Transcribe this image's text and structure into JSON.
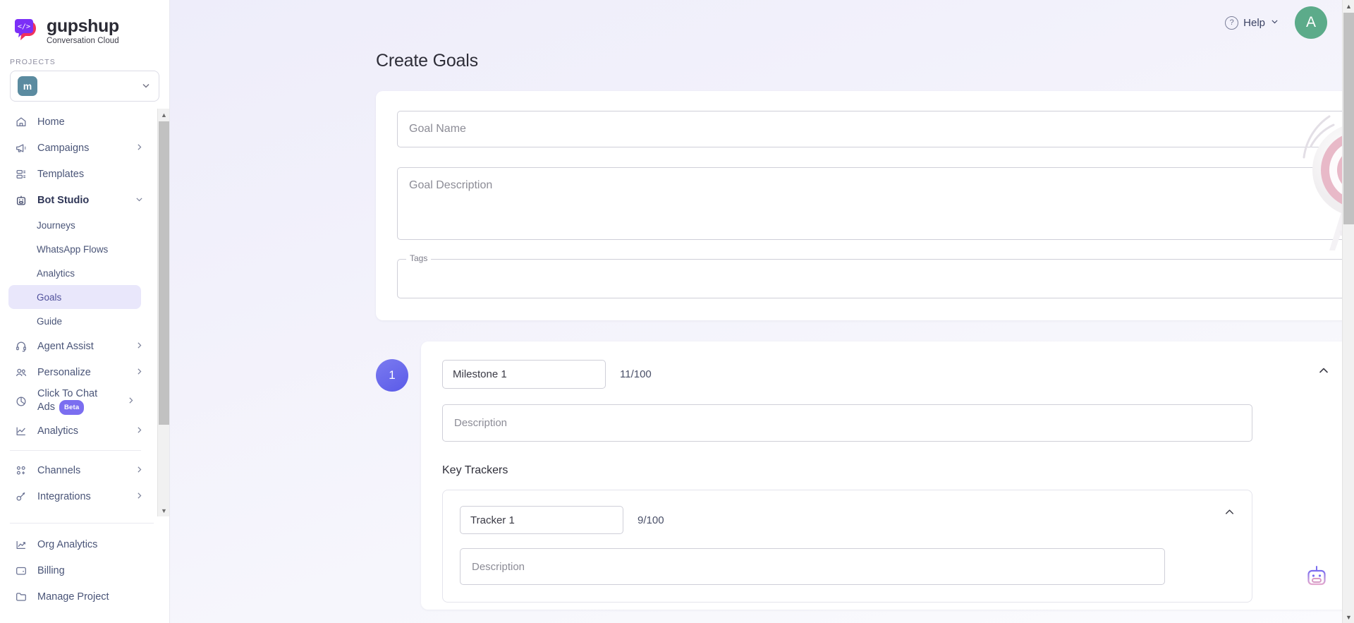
{
  "brand": {
    "name": "gupshup",
    "tagline": "Conversation Cloud",
    "logo_icon": "code-bubble-icon"
  },
  "sidebar": {
    "projects_label": "PROJECTS",
    "project": {
      "avatar_letter": "m",
      "chevron_icon": "chevron-down-icon"
    },
    "items": [
      {
        "label": "Home",
        "icon": "home-icon",
        "has_chevron": false
      },
      {
        "label": "Campaigns",
        "icon": "megaphone-icon",
        "has_chevron": true
      },
      {
        "label": "Templates",
        "icon": "template-icon",
        "has_chevron": false
      },
      {
        "label": "Bot Studio",
        "icon": "robot-icon",
        "has_chevron": true,
        "expanded": true
      }
    ],
    "bot_studio_children": [
      {
        "label": "Journeys",
        "active": false
      },
      {
        "label": "WhatsApp Flows",
        "active": false
      },
      {
        "label": "Analytics",
        "active": false
      },
      {
        "label": "Goals",
        "active": true
      },
      {
        "label": "Guide",
        "active": false
      }
    ],
    "items_after": [
      {
        "label": "Agent Assist",
        "icon": "headset-icon",
        "has_chevron": true
      },
      {
        "label": "Personalize",
        "icon": "people-icon",
        "has_chevron": true
      },
      {
        "label": "Click To Chat Ads",
        "icon": "pie-chart-icon",
        "has_chevron": true,
        "badge": "Beta"
      },
      {
        "label": "Analytics",
        "icon": "line-chart-icon",
        "has_chevron": true
      }
    ],
    "items_group2": [
      {
        "label": "Channels",
        "icon": "channels-icon",
        "has_chevron": true
      },
      {
        "label": "Integrations",
        "icon": "integrations-icon",
        "has_chevron": true
      }
    ],
    "items_bottom": [
      {
        "label": "Org Analytics",
        "icon": "trend-up-icon",
        "has_chevron": false
      },
      {
        "label": "Billing",
        "icon": "wallet-icon",
        "has_chevron": false
      },
      {
        "label": "Manage Project",
        "icon": "folder-icon",
        "has_chevron": false
      }
    ]
  },
  "topbar": {
    "help_label": "Help",
    "help_icon": "question-circle-icon",
    "help_chevron": "chevron-down-icon",
    "avatar_letter": "A",
    "avatar_color": "#5cab8a"
  },
  "main": {
    "page_title": "Create Goals",
    "goal": {
      "name_placeholder": "Goal Name",
      "name_value": "",
      "description_placeholder": "Goal Description",
      "description_value": "",
      "tags_legend": "Tags",
      "tags_value": "",
      "illustration": "dartboard-target-icon"
    },
    "milestones": [
      {
        "badge_number": "1",
        "name_value": "Milestone 1",
        "name_counter": "11/100",
        "description_placeholder": "Description",
        "description_value": "",
        "collapse_icon": "chevron-up-icon",
        "key_trackers_title": "Key Trackers",
        "trackers": [
          {
            "name_value": "Tracker 1",
            "name_counter": "9/100",
            "description_placeholder": "Description",
            "description_value": "",
            "collapse_icon": "chevron-up-icon"
          }
        ]
      }
    ],
    "bot_fab_icon": "bot-assistant-icon"
  },
  "colors": {
    "accent": "#5a5ae8",
    "active_nav_bg": "#e9e7fb",
    "beta_badge": "#7b6ef0",
    "project_avatar": "#5b8ba0"
  }
}
